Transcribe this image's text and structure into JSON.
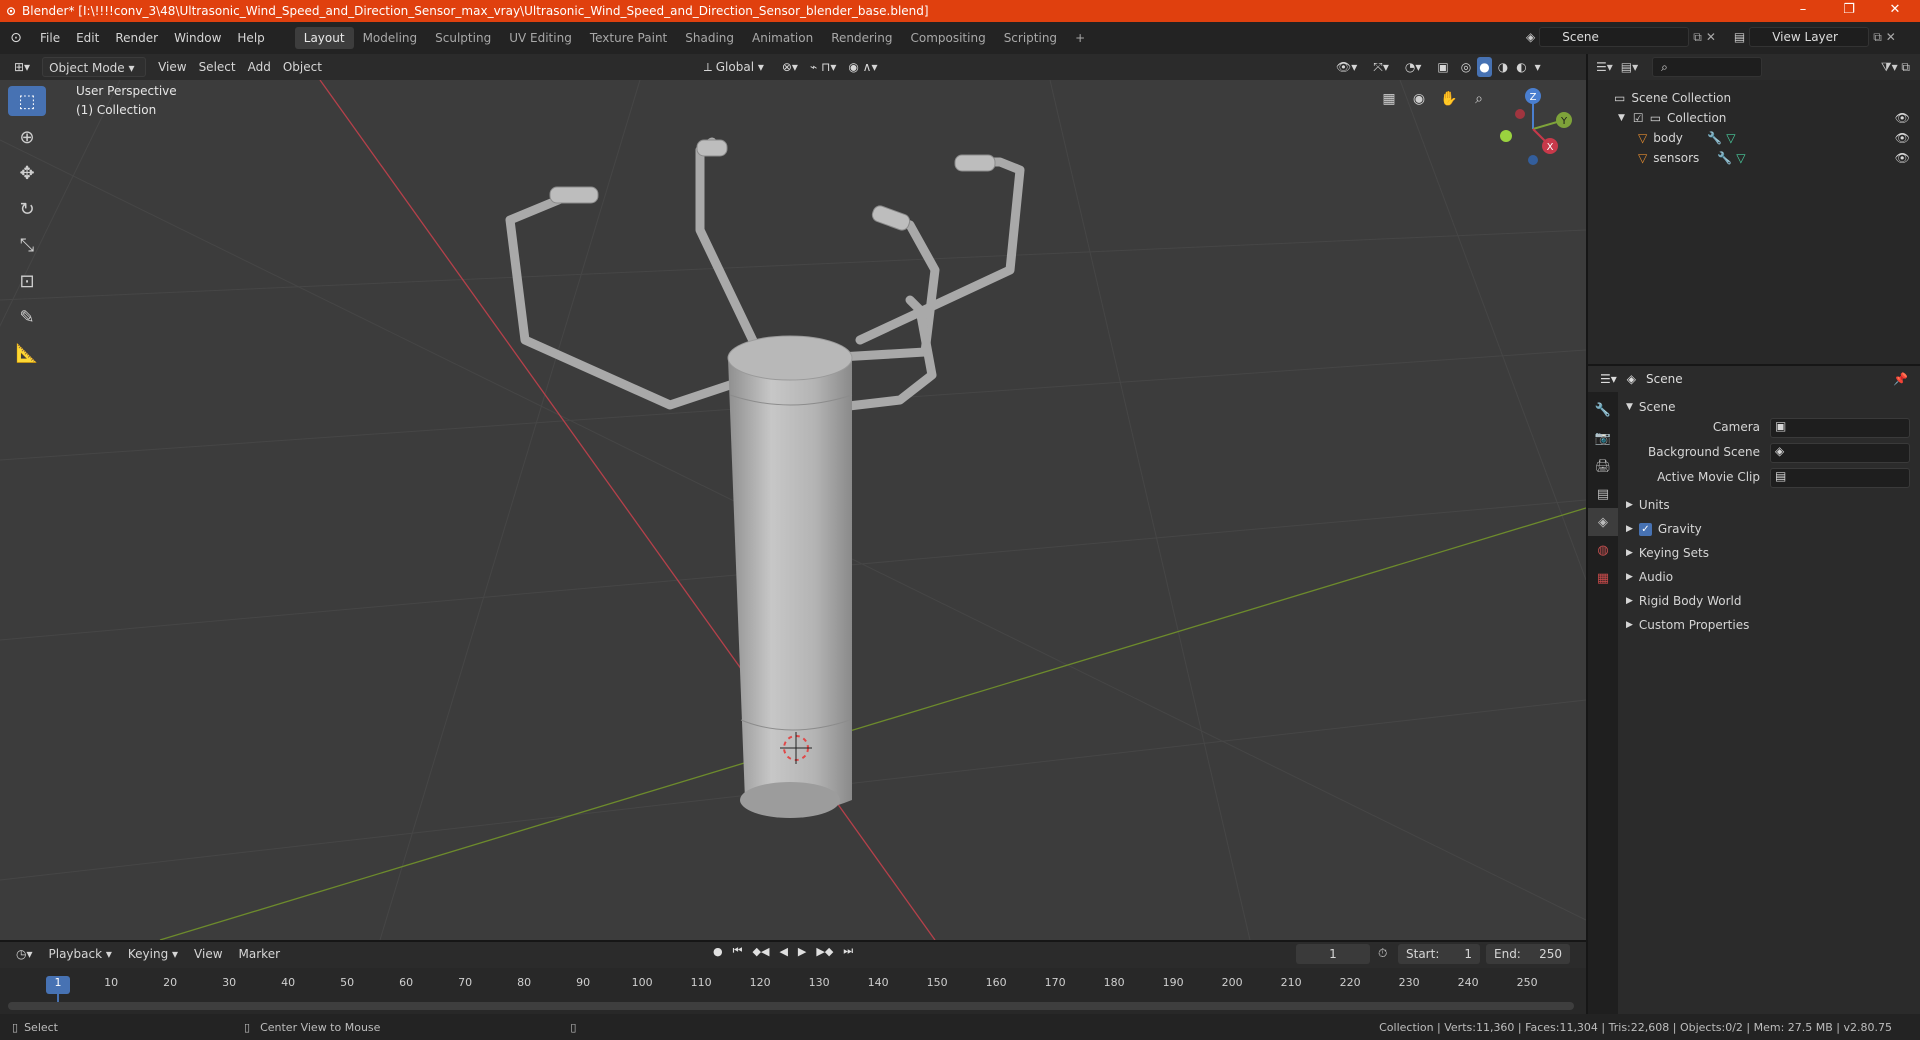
{
  "window": {
    "title": "Blender* [I:\\!!!!conv_3\\48\\Ultrasonic_Wind_Speed_and_Direction_Sensor_max_vray\\Ultrasonic_Wind_Speed_and_Direction_Sensor_blender_base.blend]",
    "minimize": "–",
    "restore": "❐",
    "close": "✕"
  },
  "menu": [
    "File",
    "Edit",
    "Render",
    "Window",
    "Help"
  ],
  "workspaces": [
    "Layout",
    "Modeling",
    "Sculpting",
    "UV Editing",
    "Texture Paint",
    "Shading",
    "Animation",
    "Rendering",
    "Compositing",
    "Scripting"
  ],
  "workspace_add": "+",
  "scene_field": "Scene",
  "view_layer_field": "View Layer",
  "viewport_header": {
    "mode": "Object Mode",
    "menus": [
      "View",
      "Select",
      "Add",
      "Object"
    ],
    "orientation": "Global"
  },
  "viewport": {
    "perspective": "User Perspective",
    "collection": "(1) Collection",
    "gizmo": {
      "x": "X",
      "y": "Y",
      "z": "Z"
    }
  },
  "outliner": {
    "root": "Scene Collection",
    "collection": "Collection",
    "items": [
      "body",
      "sensors"
    ]
  },
  "properties": {
    "header": "Scene",
    "panel": "Scene",
    "camera_label": "Camera",
    "bg_scene_label": "Background Scene",
    "movie_clip_label": "Active Movie Clip",
    "sections": [
      "Units",
      "Gravity",
      "Keying Sets",
      "Audio",
      "Rigid Body World",
      "Custom Properties"
    ],
    "gravity_checked": true
  },
  "timeline": {
    "menus": [
      "Playback",
      "Keying",
      "View",
      "Marker"
    ],
    "current_frame": "1",
    "start_label": "Start:",
    "start": "1",
    "end_label": "End:",
    "end": "250",
    "ticks": [
      "1",
      "10",
      "20",
      "30",
      "40",
      "50",
      "60",
      "70",
      "80",
      "90",
      "100",
      "110",
      "120",
      "130",
      "140",
      "150",
      "160",
      "170",
      "180",
      "190",
      "200",
      "210",
      "220",
      "230",
      "240",
      "250"
    ]
  },
  "status": {
    "left": "Select",
    "middle": "Center View to Mouse",
    "right": "Collection | Verts:11,360 | Faces:11,304 | Tris:22,608 | Objects:0/2 | Mem: 27.5 MB | v2.80.75"
  },
  "colors": {
    "accent": "#4772b3",
    "titlebar": "#e0400e",
    "x_axis": "#c8394a",
    "y_axis": "#7ea33a"
  }
}
